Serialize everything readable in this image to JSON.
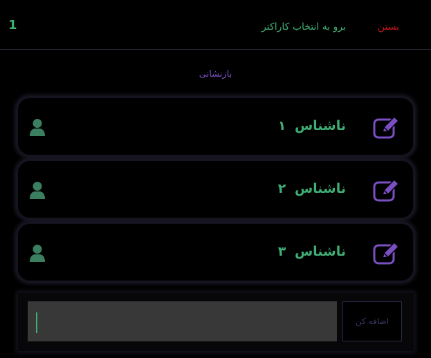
{
  "header": {
    "counter": "1",
    "goto_character_select": "برو به انتخاب کاراکتر",
    "close": "بستن"
  },
  "reset_label": "بازنشانی",
  "characters": [
    {
      "name": "ناشناس",
      "number": "۱"
    },
    {
      "name": "ناشناس",
      "number": "۲"
    },
    {
      "name": "ناشناس",
      "number": "۳"
    }
  ],
  "add_bar": {
    "input_value": "",
    "button_label": "اضافه کن"
  },
  "colors": {
    "accent_green": "#3fae74",
    "accent_purple": "#7b4fc4",
    "close_red": "#c0141c",
    "input_bg": "#383838"
  },
  "icons": {
    "edit": "edit-icon",
    "user": "user-icon"
  }
}
